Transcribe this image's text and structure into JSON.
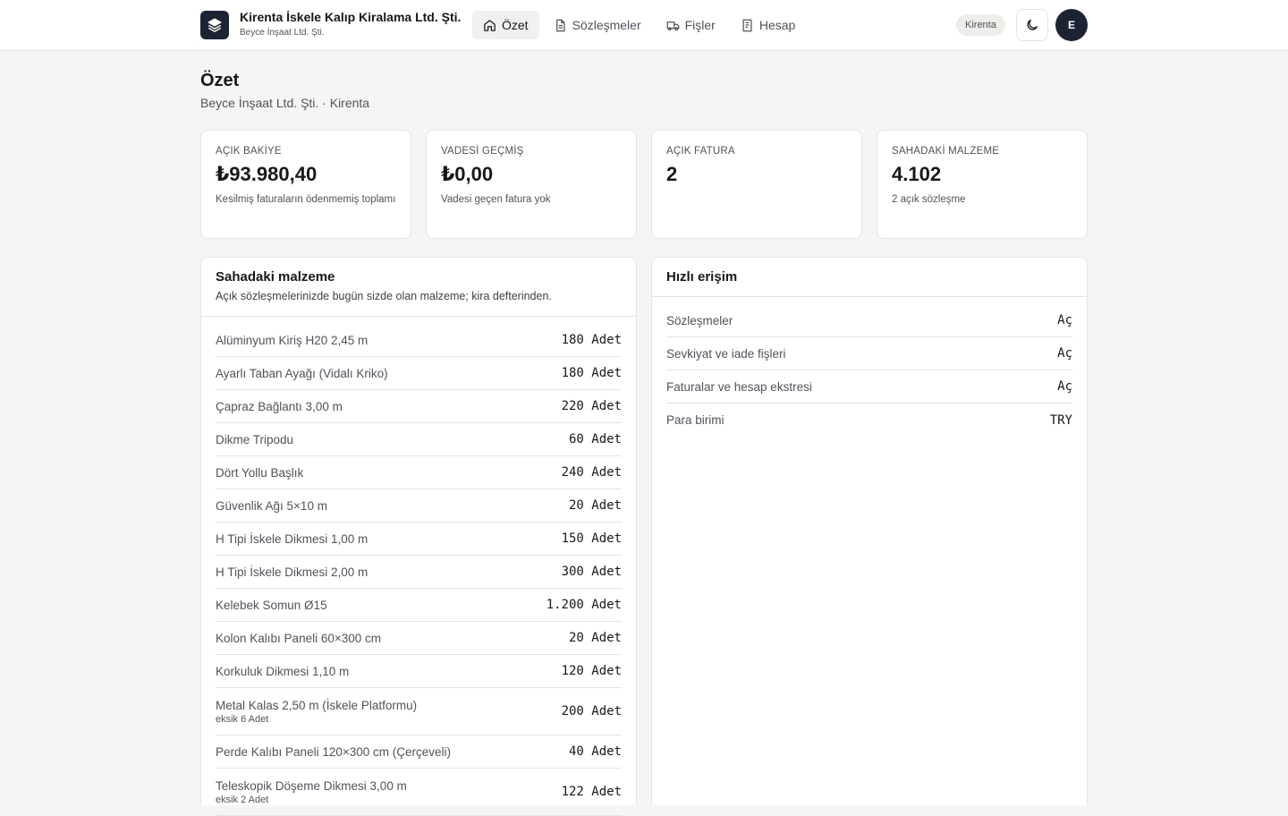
{
  "app": {
    "name": "Kirenta İskele Kalıp Kiralama Ltd. Şti.",
    "subtitle": "Beyce İnşaat Ltd. Şti.",
    "logo_icon": "layers-icon"
  },
  "nav": [
    {
      "label": "Özet",
      "icon": "home-icon",
      "active": true
    },
    {
      "label": "Sözleşmeler",
      "icon": "document-icon",
      "active": false
    },
    {
      "label": "Fişler",
      "icon": "truck-icon",
      "active": false
    },
    {
      "label": "Hesap",
      "icon": "receipt-icon",
      "active": false
    }
  ],
  "header": {
    "badge": "Kirenta",
    "theme_icon": "moon-icon",
    "avatar": "E"
  },
  "page": {
    "title": "Özet",
    "subtitle": "Beyce İnşaat Ltd. Şti. · Kirenta"
  },
  "stats": [
    {
      "label": "AÇIK BAKİYE",
      "value": "₺93.980,40",
      "desc": "Kesilmiş faturaların ödenmemiş toplamı"
    },
    {
      "label": "VADESİ GEÇMİŞ",
      "value": "₺0,00",
      "desc": "Vadesi geçen fatura yok"
    },
    {
      "label": "AÇIK FATURA",
      "value": "2",
      "desc": ""
    },
    {
      "label": "SAHADAKİ MALZEME",
      "value": "4.102",
      "desc": "2 açık sözleşme"
    }
  ],
  "materials": {
    "title": "Sahadaki malzeme",
    "desc": "Açık sözleşmelerinizde bugün sizde olan malzeme; kira defterinden.",
    "items": [
      {
        "name": "Alüminyum Kiriş H20 2,45 m",
        "qty": "180 Adet",
        "note": ""
      },
      {
        "name": "Ayarlı Taban Ayağı (Vidalı Kriko)",
        "qty": "180 Adet",
        "note": ""
      },
      {
        "name": "Çapraz Bağlantı 3,00 m",
        "qty": "220 Adet",
        "note": ""
      },
      {
        "name": "Dikme Tripodu",
        "qty": "60 Adet",
        "note": ""
      },
      {
        "name": "Dört Yollu Başlık",
        "qty": "240 Adet",
        "note": ""
      },
      {
        "name": "Güvenlik Ağı 5×10 m",
        "qty": "20 Adet",
        "note": ""
      },
      {
        "name": "H Tipi İskele Dikmesi 1,00 m",
        "qty": "150 Adet",
        "note": ""
      },
      {
        "name": "H Tipi İskele Dikmesi 2,00 m",
        "qty": "300 Adet",
        "note": ""
      },
      {
        "name": "Kelebek Somun Ø15",
        "qty": "1.200 Adet",
        "note": ""
      },
      {
        "name": "Kolon Kalıbı Paneli 60×300 cm",
        "qty": "20 Adet",
        "note": ""
      },
      {
        "name": "Korkuluk Dikmesi 1,10 m",
        "qty": "120 Adet",
        "note": ""
      },
      {
        "name": "Metal Kalas 2,50 m (İskele Platformu)",
        "qty": "200 Adet",
        "note": "eksik 6 Adet"
      },
      {
        "name": "Perde Kalıbı Paneli 120×300 cm (Çerçeveli)",
        "qty": "40 Adet",
        "note": ""
      },
      {
        "name": "Teleskopik Döşeme Dikmesi 3,00 m",
        "qty": "122 Adet",
        "note": "eksik 2 Adet"
      }
    ]
  },
  "quick": {
    "title": "Hızlı erişim",
    "items": [
      {
        "label": "Sözleşmeler",
        "action": "Aç"
      },
      {
        "label": "Sevkiyat ve iade fişleri",
        "action": "Aç"
      },
      {
        "label": "Faturalar ve hesap ekstresi",
        "action": "Aç"
      },
      {
        "label": "Para birimi",
        "action": "TRY"
      }
    ]
  }
}
